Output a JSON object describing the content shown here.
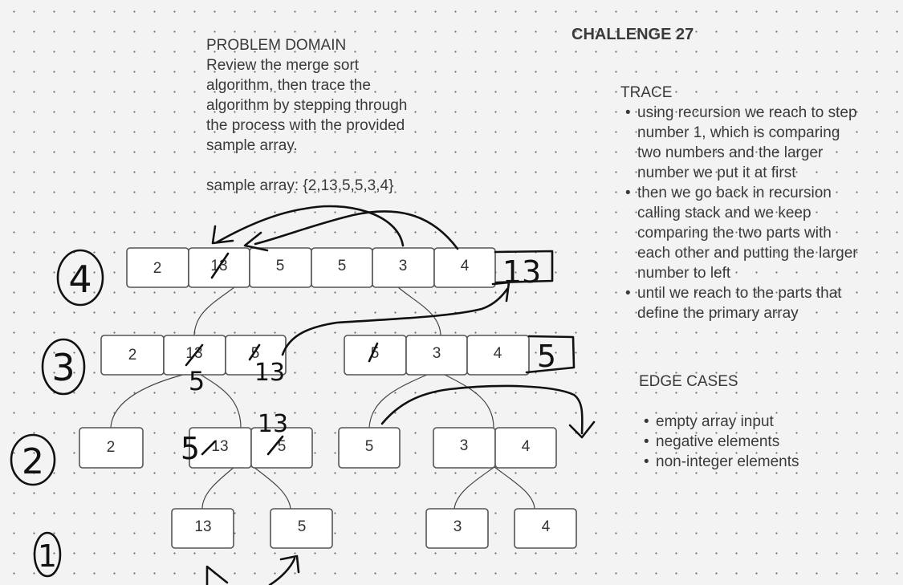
{
  "problem": {
    "title": "PROBLEM DOMAIN",
    "lines": [
      "Review the merge sort",
      "algorithm, then trace the",
      "algorithm by stepping through",
      "the process with the provided",
      "sample array."
    ],
    "sample": "sample array: {2,13,5,5,3,4}"
  },
  "challenge": "CHALLENGE 27",
  "trace": {
    "title": "TRACE",
    "items": [
      "using recursion we reach to step number 1, which is comparing two numbers and the larger number we put it at first",
      "then we go back in recursion calling stack and we keep comparing the two parts with each other and putting the larger number to left",
      "until we reach to the parts that define the primary array"
    ]
  },
  "edge_cases": {
    "title": "EDGE CASES",
    "items": [
      "empty array input",
      "negative elements",
      "non-integer elements"
    ]
  },
  "levels": {
    "level4": {
      "label": "4",
      "cells": [
        "2",
        "13",
        "5",
        "5",
        "3",
        "4"
      ]
    },
    "level3": {
      "label": "3",
      "left": [
        "2",
        "13",
        "5"
      ],
      "right": [
        "5",
        "3",
        "4"
      ]
    },
    "level2": {
      "label": "2",
      "cells": [
        "2",
        "13",
        "5",
        "5",
        "3",
        "4"
      ]
    },
    "level1": {
      "label": "1",
      "cells": [
        "13",
        "5",
        "3",
        "4"
      ]
    }
  },
  "handwritten": {
    "l4_extra": "13",
    "l3_extra": "5",
    "l3_under": "5",
    "l3_swap": "13",
    "l2_above": "13",
    "l2_side": "5"
  }
}
